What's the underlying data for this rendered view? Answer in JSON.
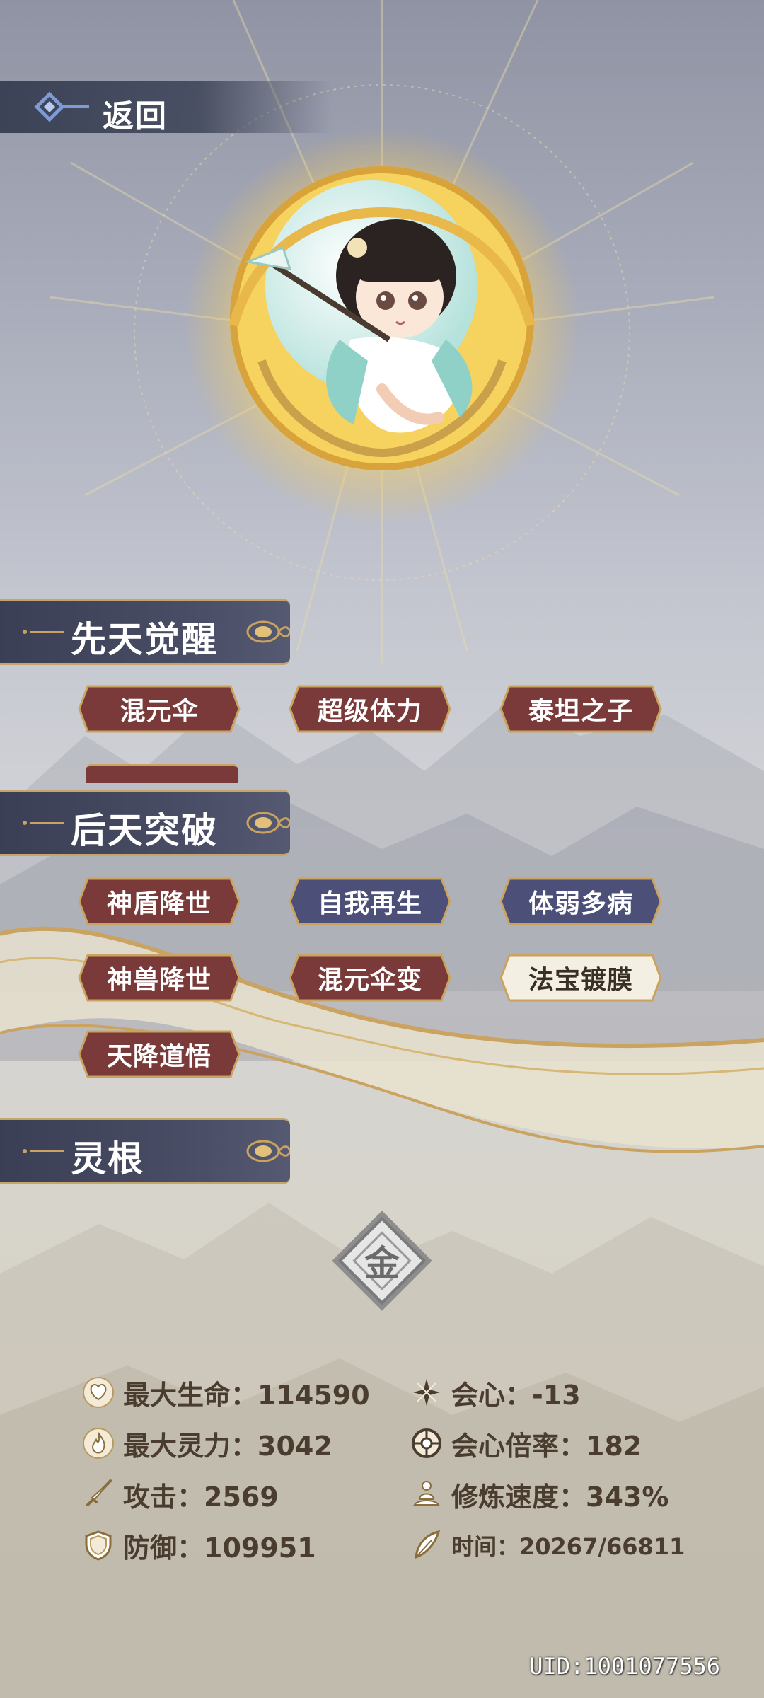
{
  "header": {
    "back_label": "返回"
  },
  "sections": {
    "innate_title": "先天觉醒",
    "acquired_title": "后天突破",
    "root_title": "灵根"
  },
  "innate_tags": [
    "混元伞",
    "超级体力",
    "泰坦之子"
  ],
  "acquired_tags": [
    "神盾降世",
    "自我再生",
    "体弱多病",
    "神兽降世",
    "混元伞变",
    "法宝镀膜",
    "天降道悟"
  ],
  "spirit_root": {
    "glyph": "金"
  },
  "stats": {
    "max_hp": "最大生命：114590",
    "crit": "会心：-13",
    "max_mana": "最大灵力：3042",
    "crit_rate": "会心倍率：182",
    "attack": "攻击：2569",
    "train_speed": "修炼速度：343%",
    "defense": "防御：109951",
    "time": "时间：20267/66811"
  },
  "uid": "UID:1001077556",
  "colors": {
    "tag_red": "#7a3a3a",
    "tag_blue": "#4c4f78",
    "tag_cream": "#f3efe2",
    "gold": "#c9a35f",
    "section_bg": "#3f4359"
  }
}
